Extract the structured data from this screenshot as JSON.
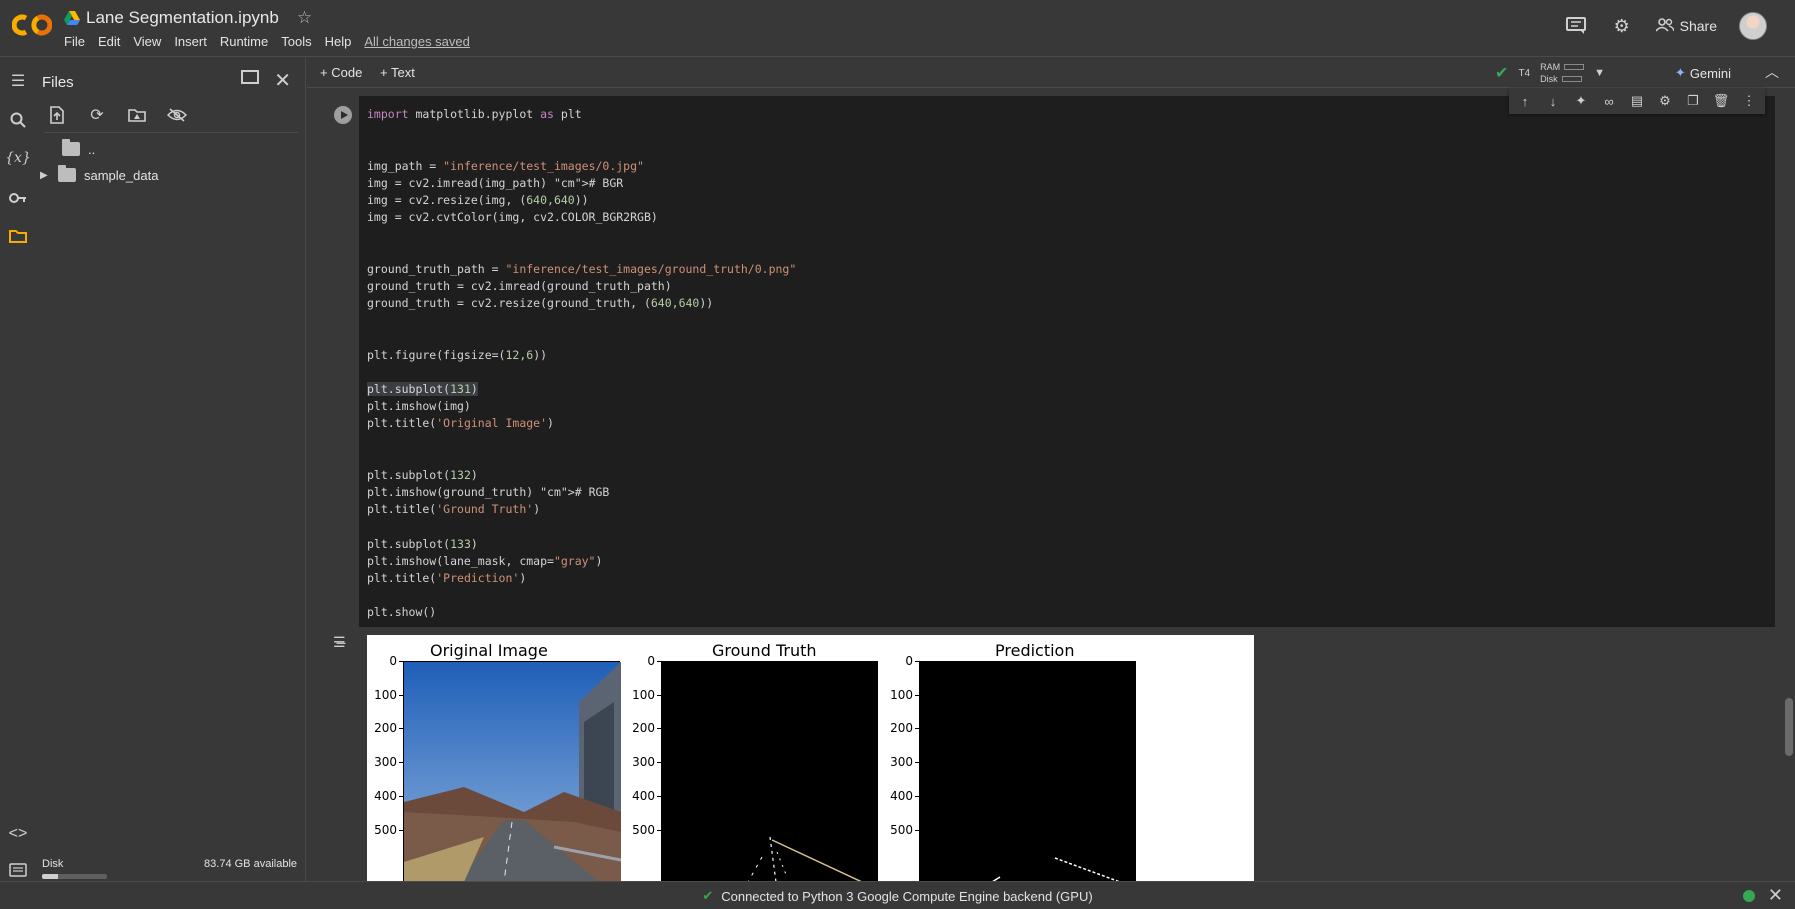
{
  "header": {
    "notebook_title": "Lane Segmentation.ipynb",
    "menu": [
      "File",
      "Edit",
      "View",
      "Insert",
      "Runtime",
      "Tools",
      "Help"
    ],
    "save_status": "All changes saved",
    "share_label": "Share"
  },
  "files_panel": {
    "title": "Files",
    "parent_dir": "..",
    "folder": "sample_data",
    "disk_label": "Disk",
    "disk_available": "83.74 GB available",
    "disk_used_fraction": 0.25
  },
  "toolbar": {
    "code_label": "Code",
    "text_label": "Text",
    "runtime_type": "T4",
    "ram_label": "RAM",
    "disk_label": "Disk",
    "gemini_label": "Gemini"
  },
  "code_lines": [
    "import matplotlib.pyplot as plt",
    "",
    "",
    "img_path = \"inference/test_images/0.jpg\"",
    "img = cv2.imread(img_path) # BGR",
    "img = cv2.resize(img, (640,640))",
    "img = cv2.cvtColor(img, cv2.COLOR_BGR2RGB)",
    "",
    "",
    "ground_truth_path = \"inference/test_images/ground_truth/0.png\"",
    "ground_truth = cv2.imread(ground_truth_path)",
    "ground_truth = cv2.resize(ground_truth, (640,640))",
    "",
    "",
    "plt.figure(figsize=(12,6))",
    "",
    "plt.subplot(131)",
    "plt.imshow(img)",
    "plt.title('Original Image')",
    "",
    "",
    "plt.subplot(132)",
    "plt.imshow(ground_truth) # RGB",
    "plt.title('Ground Truth')",
    "",
    "plt.subplot(133)",
    "plt.imshow(lane_mask, cmap=\"gray\")",
    "plt.title('Prediction')",
    "",
    "plt.show()"
  ],
  "output": {
    "panels": [
      {
        "title": "Original Image"
      },
      {
        "title": "Ground Truth"
      },
      {
        "title": "Prediction"
      }
    ],
    "y_ticks": [
      "0",
      "100",
      "200",
      "300",
      "400",
      "500"
    ]
  },
  "status_bar": {
    "message": "Connected to Python 3 Google Compute Engine backend (GPU)"
  },
  "colors": {
    "accent_orange": "#f9ab00",
    "connected_green": "#34a853"
  }
}
